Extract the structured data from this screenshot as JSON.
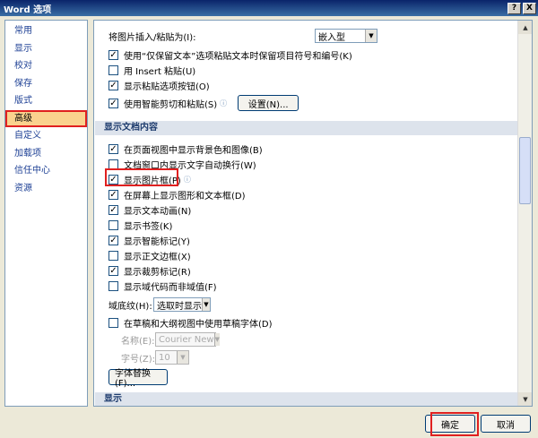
{
  "window": {
    "title": "Word 选项",
    "help_label": "?",
    "close_label": "X"
  },
  "sidebar": {
    "items": [
      {
        "label": "常用"
      },
      {
        "label": "显示"
      },
      {
        "label": "校对"
      },
      {
        "label": "保存"
      },
      {
        "label": "版式"
      },
      {
        "label": "高级"
      },
      {
        "label": "自定义"
      },
      {
        "label": "加载项"
      },
      {
        "label": "信任中心"
      },
      {
        "label": "资源"
      }
    ],
    "selected": "高级"
  },
  "cut_copy_paste": {
    "insert_paste_label": "将图片插入/粘贴为(I):",
    "insert_paste_value": "嵌入型",
    "keep_bullets_label": "使用“仅保留文本”选项粘贴文本时保留项目符号和编号(K)",
    "use_insert_label": "用 Insert 粘贴(U)",
    "show_paste_options_label": "显示粘贴选项按钮(O)",
    "smart_cut_label": "使用智能剪切和粘贴(S)",
    "settings_button": "设置(N)..."
  },
  "document_content": {
    "header": "显示文档内容",
    "items": [
      {
        "label": "在页面视图中显示背景色和图像(B)",
        "checked": true,
        "disabled": false
      },
      {
        "label": "文档窗口内显示文字自动换行(W)",
        "checked": false,
        "disabled": false
      },
      {
        "label": "显示图片框(P)",
        "checked": true,
        "disabled": false
      },
      {
        "label": "在屏幕上显示图形和文本框(D)",
        "checked": true,
        "disabled": false
      },
      {
        "label": "显示文本动画(N)",
        "checked": true,
        "disabled": false
      },
      {
        "label": "显示书签(K)",
        "checked": false,
        "disabled": false
      },
      {
        "label": "显示智能标记(Y)",
        "checked": true,
        "disabled": false
      },
      {
        "label": "显示正文边框(X)",
        "checked": false,
        "disabled": false
      },
      {
        "label": "显示裁剪标记(R)",
        "checked": true,
        "disabled": false
      },
      {
        "label": "显示域代码而非域值(F)",
        "checked": false,
        "disabled": false
      }
    ],
    "field_shading_label": "域底纹(H):",
    "field_shading_value": "选取时显示",
    "draft_font_label": "在草稿和大纲视图中使用草稿字体(D)",
    "name_label": "名称(E):",
    "name_value": "Courier New",
    "size_label": "字号(Z):",
    "size_value": "10",
    "font_sub_button": "字体替换(F)..."
  },
  "display": {
    "header": "显示"
  },
  "buttons": {
    "ok": "确定",
    "cancel": "取消"
  },
  "colors": {
    "highlight_red": "#e02020",
    "selected_bg": "#fad28e",
    "section_bg": "#dde3ec"
  }
}
